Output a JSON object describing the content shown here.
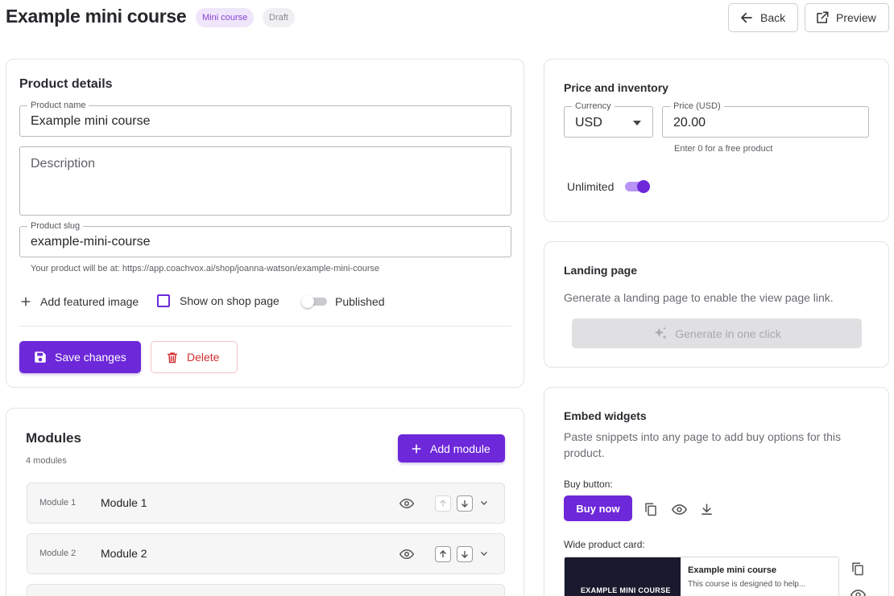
{
  "header": {
    "title": "Example mini course",
    "badge_type": "Mini course",
    "badge_status": "Draft",
    "back_label": "Back",
    "preview_label": "Preview"
  },
  "product_details": {
    "title": "Product details",
    "name_label": "Product name",
    "name_value": "Example mini course",
    "description_placeholder": "Description",
    "slug_label": "Product slug",
    "slug_value": "example-mini-course",
    "url_hint": "Your product will be at: https://app.coachvox.ai/shop/joanna-watson/example-mini-course",
    "add_image_label": "Add featured image",
    "show_on_shop_label": "Show on shop page",
    "published_label": "Published",
    "save_label": "Save changes",
    "delete_label": "Delete"
  },
  "modules": {
    "title": "Modules",
    "count_label": "4 modules",
    "add_label": "Add module",
    "items": [
      {
        "number": "Module 1",
        "name": "Module 1"
      },
      {
        "number": "Module 2",
        "name": "Module 2"
      }
    ]
  },
  "price": {
    "title": "Price and inventory",
    "currency_label": "Currency",
    "currency_value": "USD",
    "price_label": "Price (USD)",
    "price_value": "20.00",
    "price_hint": "Enter 0 for a free product",
    "unlimited_label": "Unlimited"
  },
  "landing": {
    "title": "Landing page",
    "description": "Generate a landing page to enable the view page link.",
    "generate_label": "Generate in one click"
  },
  "embed": {
    "title": "Embed widgets",
    "description": "Paste snippets into any page to add buy options for this product.",
    "buy_button_label": "Buy button:",
    "buy_now_label": "Buy now",
    "wide_card_label": "Wide product card:",
    "card_image_text": "EXAMPLE MINI COURSE",
    "card_title": "Example mini course",
    "card_desc": "This course is designed to help..."
  },
  "colors": {
    "accent": "#6d28d9",
    "danger": "#d32f2f",
    "badge_mini_bg": "#efe6fb",
    "badge_mini_text": "#8a45d6"
  },
  "icons": [
    "arrow-left-icon",
    "external-link-icon",
    "plus-icon",
    "save-icon",
    "trash-icon",
    "eye-icon",
    "arrow-up-icon",
    "arrow-down-icon",
    "chevron-down-icon",
    "sparkles-icon",
    "copy-icon",
    "download-icon",
    "dropdown-caret-icon"
  ]
}
